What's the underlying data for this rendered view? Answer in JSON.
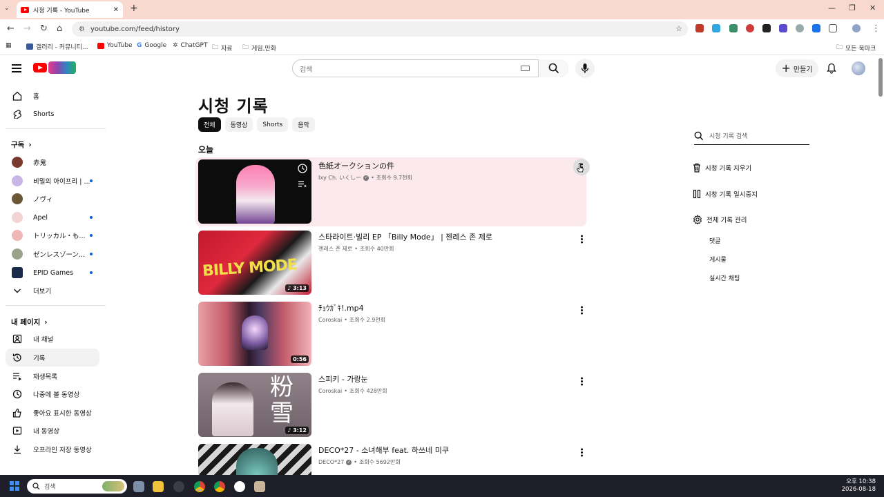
{
  "browser": {
    "tab_title": "시청 기록 - YouTube",
    "url": "youtube.com/feed/history",
    "bookmarks": [
      "갤러리 - 커뮤니티...",
      "YouTube",
      "Google",
      "ChatGPT",
      "자료",
      "게임,만화"
    ],
    "all_bookmarks": "모든 북마크"
  },
  "header": {
    "search_placeholder": "검색",
    "create_label": "만들기"
  },
  "sidebar": {
    "home": "홈",
    "shorts": "Shorts",
    "subscriptions_heading": "구독",
    "subscriptions": [
      {
        "name": "赤鬼",
        "color": "#7a3b2e",
        "dot": false
      },
      {
        "name": "비밀의 아이프리 | ...",
        "color": "#c9b6e6",
        "dot": true
      },
      {
        "name": "ノヴィ",
        "color": "#6b5637",
        "dot": false
      },
      {
        "name": "Apel",
        "color": "#f2d4d4",
        "dot": true
      },
      {
        "name": "トリッカル・も...",
        "color": "#f0b6b6",
        "dot": true
      },
      {
        "name": "ゼンレスゾーン...",
        "color": "#9aa38c",
        "dot": true
      },
      {
        "name": "EPID Games",
        "color": "#1a2a4a",
        "dot": true
      }
    ],
    "more": "더보기",
    "you_heading": "내 페이지",
    "you_items": [
      "내 채널",
      "기록",
      "재생목록",
      "나중에 볼 동영상",
      "좋아요 표시한 동영상",
      "내 동영상",
      "오프라인 저장 동영상"
    ]
  },
  "main": {
    "title": "시청 기록",
    "chips": [
      "전체",
      "동영상",
      "Shorts",
      "음악"
    ],
    "section": "오늘",
    "videos": [
      {
        "title": "色紙オークションの件",
        "channel": "Ixy Ch. いくしー",
        "verified": true,
        "views": "조회수 9.7천회",
        "duration": ""
      },
      {
        "title": "스타라이트·빌리 EP 「Billy Mode」 | 젠레스 존 제로",
        "channel": "젠레스 존 제로",
        "verified": false,
        "views": "조회수 40만회",
        "duration": "3:13"
      },
      {
        "title": "ﾁｮｳｶﾞｷ!.mp4",
        "channel": "Coroskai",
        "verified": false,
        "views": "조회수 2.9천회",
        "duration": "0:56"
      },
      {
        "title": "스피키 - 가랑눈",
        "channel": "Coroskai",
        "verified": false,
        "views": "조회수 428만회",
        "duration": "3:12"
      },
      {
        "title": "DECO*27 - 소녀해부 feat. 하쓰네 미쿠",
        "channel": "DECO*27",
        "verified": true,
        "views": "조회수 5692만회",
        "duration": ""
      }
    ]
  },
  "right_panel": {
    "search_placeholder": "시청 기록 검색",
    "clear": "시청 기록 지우기",
    "pause": "시청 기록 일시중지",
    "manage": "전체 기록 관리",
    "sub_items": [
      "댓글",
      "게시물",
      "실시간 채팅"
    ]
  },
  "taskbar": {
    "search_placeholder": "검색",
    "time": "오후 10:38",
    "date": "2026-08-18"
  }
}
